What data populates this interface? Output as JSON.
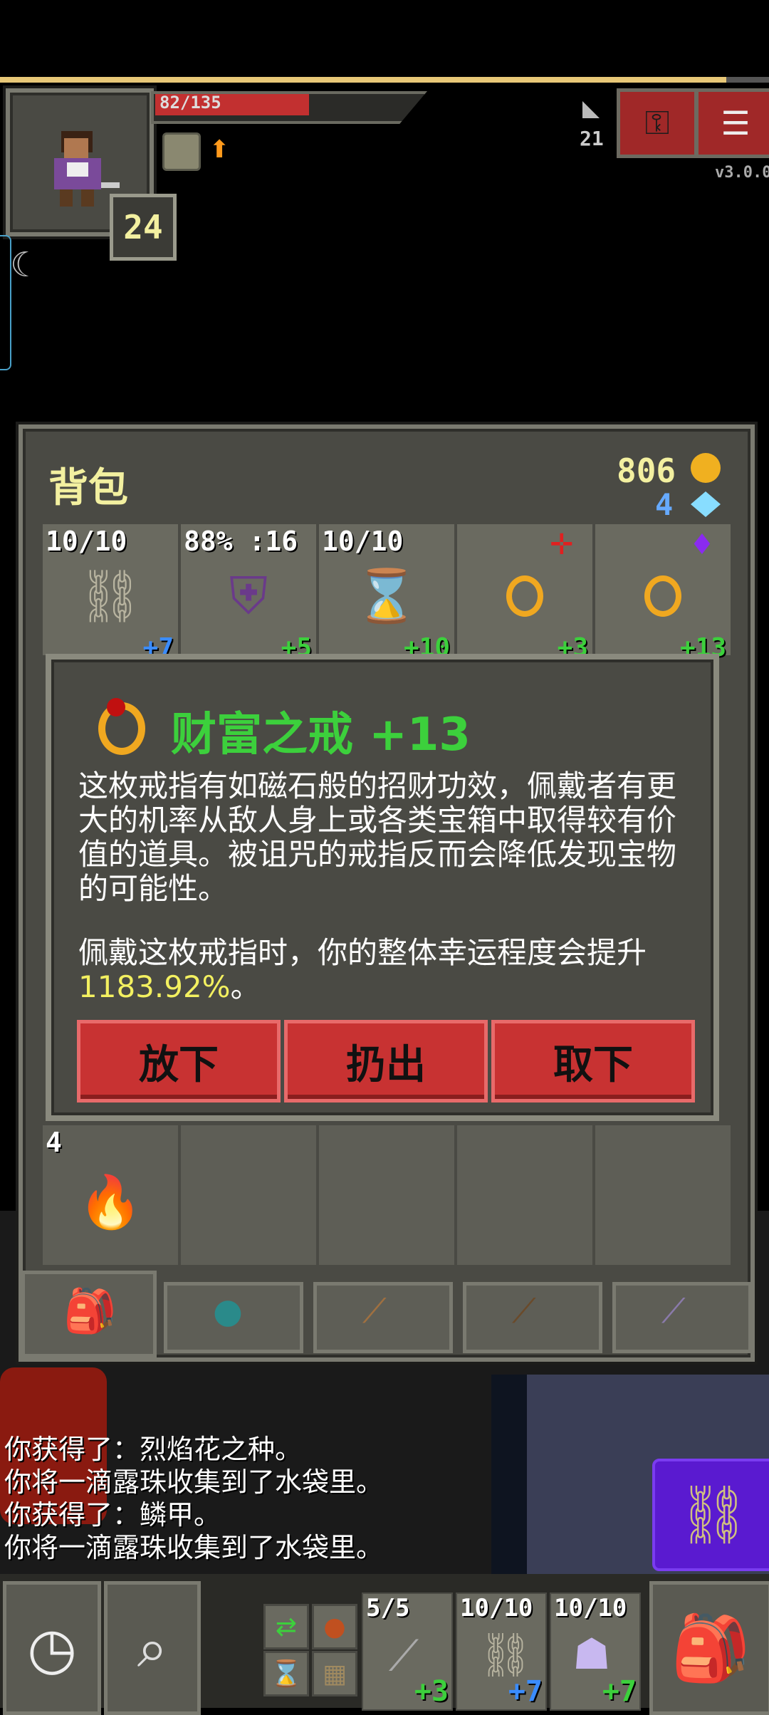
{
  "hud": {
    "hp_text": "82/135",
    "hp_fraction": 0.607,
    "xp_fraction": 0.944,
    "hero_level": "24",
    "depth": "21",
    "version": "v3.0.0",
    "journal_icon": "key-icon",
    "menu_icon": "menu-icon"
  },
  "inventory": {
    "title": "背包",
    "gold": "806",
    "energy": "4",
    "slots": [
      {
        "label": "10/10",
        "plus": "+7",
        "plus_color": "blue",
        "icon": "flail-icon"
      },
      {
        "label": "88% :16",
        "plus": "+5",
        "plus_color": "green",
        "icon": "armor-icon"
      },
      {
        "label": "10/10",
        "plus": "+10",
        "plus_color": "green",
        "icon": "hourglass-icon"
      },
      {
        "label": "",
        "plus": "+3",
        "plus_color": "green",
        "icon": "ring-icon"
      },
      {
        "label": "",
        "plus": "+13",
        "plus_color": "green",
        "icon": "ring-icon"
      }
    ],
    "bottom_slot_label": "4"
  },
  "dialog": {
    "title": "财富之戒 +13",
    "description": "这枚戒指有如磁石般的招财功效，佩戴者有更大的机率从敌人身上或各类宝箱中取得较有价值的道具。被诅咒的戒指反而会降低发现宝物的可能性。",
    "effect_prefix": "佩戴这枚戒指时，你的整体幸运程度会提升",
    "effect_value": "1183.92%",
    "effect_suffix": "。",
    "buttons": [
      "放下",
      "扔出",
      "取下"
    ]
  },
  "log": [
    "你获得了：烈焰花之种。",
    "你将一滴露珠收集到了水袋里。",
    "你获得了：鳞甲。",
    "你将一滴露珠收集到了水袋里。"
  ],
  "quickslots": [
    {
      "label": "5/5",
      "plus": "+3",
      "color": "#3cd03c"
    },
    {
      "label": "10/10",
      "plus": "+7",
      "color": "#3a8cff"
    },
    {
      "label": "10/10",
      "plus": "+7",
      "color": "#3cd03c"
    }
  ],
  "colors": {
    "accent_green": "#3cd03c",
    "accent_yellow": "#f3f0a0",
    "button_red": "#c83232"
  }
}
